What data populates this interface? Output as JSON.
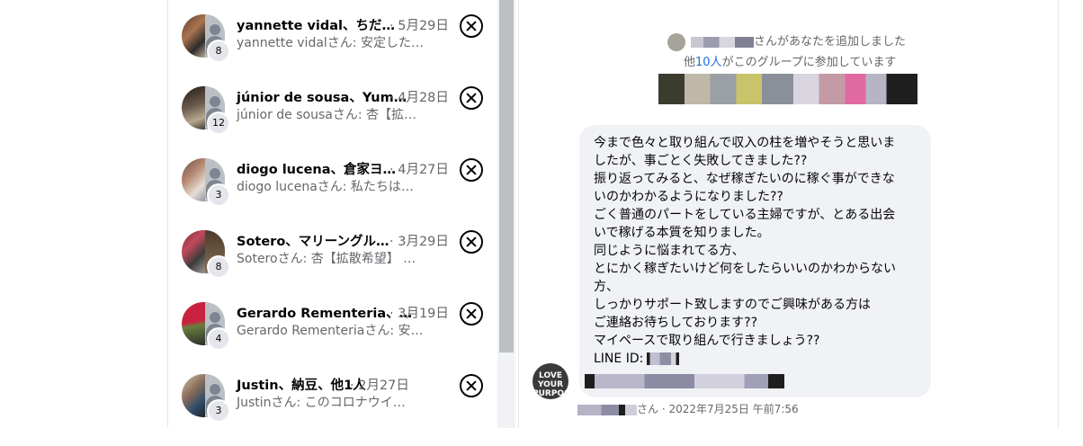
{
  "threads": [
    {
      "name": "yannette vidal、ちだ…",
      "date": "· 5月29日",
      "snippet": "yannette vidalさん: 安定した…",
      "count": "8"
    },
    {
      "name": "júnior de sousa、Yum…",
      "date": "· 4月28日",
      "snippet": "júnior de sousaさん: 杏【拡…",
      "count": "12"
    },
    {
      "name": "diogo lucena、倉家ヨ…",
      "date": "· 4月27日",
      "snippet": "diogo lucenaさん: 私たちは…",
      "count": "3"
    },
    {
      "name": "Sotero、マリーングル…",
      "date": "· 3月29日",
      "snippet": "Soteroさん: 杏【拡散希望】 …",
      "count": "8"
    },
    {
      "name": "Gerardo Rementeria、…",
      "date": "· 3月19日",
      "snippet": "Gerardo Rementeriaさん: 安…",
      "count": "4"
    },
    {
      "name": "Justin、納豆、他1人",
      "date": "· 2月27日",
      "snippet": "Justinさん: このコロナウイ…",
      "count": "3"
    }
  ],
  "chat": {
    "added_text": "さんがあなたを追加しました",
    "joined_prefix": "他",
    "joined_link": "10人",
    "joined_suffix": "がこのグループに参加しています",
    "message_lines": [
      "今まで色々と取り組んで収入の柱を増やそうと思いま",
      "したが、事ごとく失敗してきました??",
      "振り返ってみると、なぜ稼ぎたいのに稼ぐ事ができな",
      "いのかわかるようになりました??",
      "ごく普通のパートをしている主婦ですが、とある出会",
      "いで稼げる本質を知りました。",
      "同じように悩まれてる方、",
      "とにかく稼ぎたいけど何をしたらいいのかわからない",
      "方、",
      "しっかりサポート致しますのでご興味がある方は",
      "ご連絡お待ちしております??",
      "マイペースで取り組んで行きましょう??"
    ],
    "line_id_label": "LINE ID:",
    "sender_avatar_text": "LOVE YOUR PURPOSE",
    "meta": "さん · 2022年7月25日 午前7:56"
  }
}
